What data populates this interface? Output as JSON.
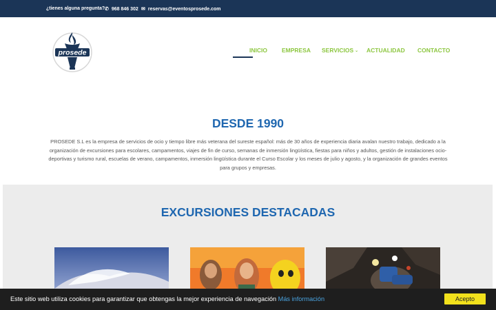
{
  "topbar": {
    "question": "¿tienes alguna pregunta?",
    "phone_icon": "phone-icon",
    "phone": "968 846 302",
    "email_icon": "envelope-icon",
    "email": "reservas@eventosprosede.com"
  },
  "logo": {
    "text": "prosede"
  },
  "nav": {
    "items": [
      {
        "label": "INICIO",
        "active": true
      },
      {
        "label": "EMPRESA"
      },
      {
        "label": "SERVICIOS",
        "has_submenu": true
      },
      {
        "label": "ACTUALIDAD"
      },
      {
        "label": "CONTACTO"
      }
    ],
    "submenu_icon": "chevron-down-icon"
  },
  "intro": {
    "title": "DESDE 1990",
    "body": "PROSEDE S.L es la empresa de servicios de ocio y tiempo libre más veterana del sureste español: más de 30 años de experiencia diaria avalan nuestro trabajo, dedicado a la organización de excursiones para escolares, campamentos, viajes de fin de curso, semanas de inmersión lingüística, fiestas para niños y adultos, gestión de instalaciones ocio-deportivas y turismo rural, escuelas de verano, campamentos, inmersión lingüística durante el Curso Escolar y los meses de julio y agosto, y la organización de grandes eventos para grupos y empresas."
  },
  "featured": {
    "title": "EXCURSIONES DESTACADAS",
    "cards": [
      {
        "image": "ciudad-artes-ciencias-image"
      },
      {
        "image": "videogame-characters-image"
      },
      {
        "image": "cave-exploration-image"
      }
    ]
  },
  "cookie": {
    "text": "Este sitio web utiliza cookies para garantizar que obtengas la mejor experiencia de navegación",
    "link": "Más información",
    "accept": "Acepto"
  },
  "colors": {
    "topbar_bg": "#1b3557",
    "nav_green": "#8cc63f",
    "heading_blue": "#1f67b0",
    "featured_bg": "#ececec",
    "cookie_bg": "#1e1e1e",
    "accept_yellow": "#f2e11c"
  }
}
